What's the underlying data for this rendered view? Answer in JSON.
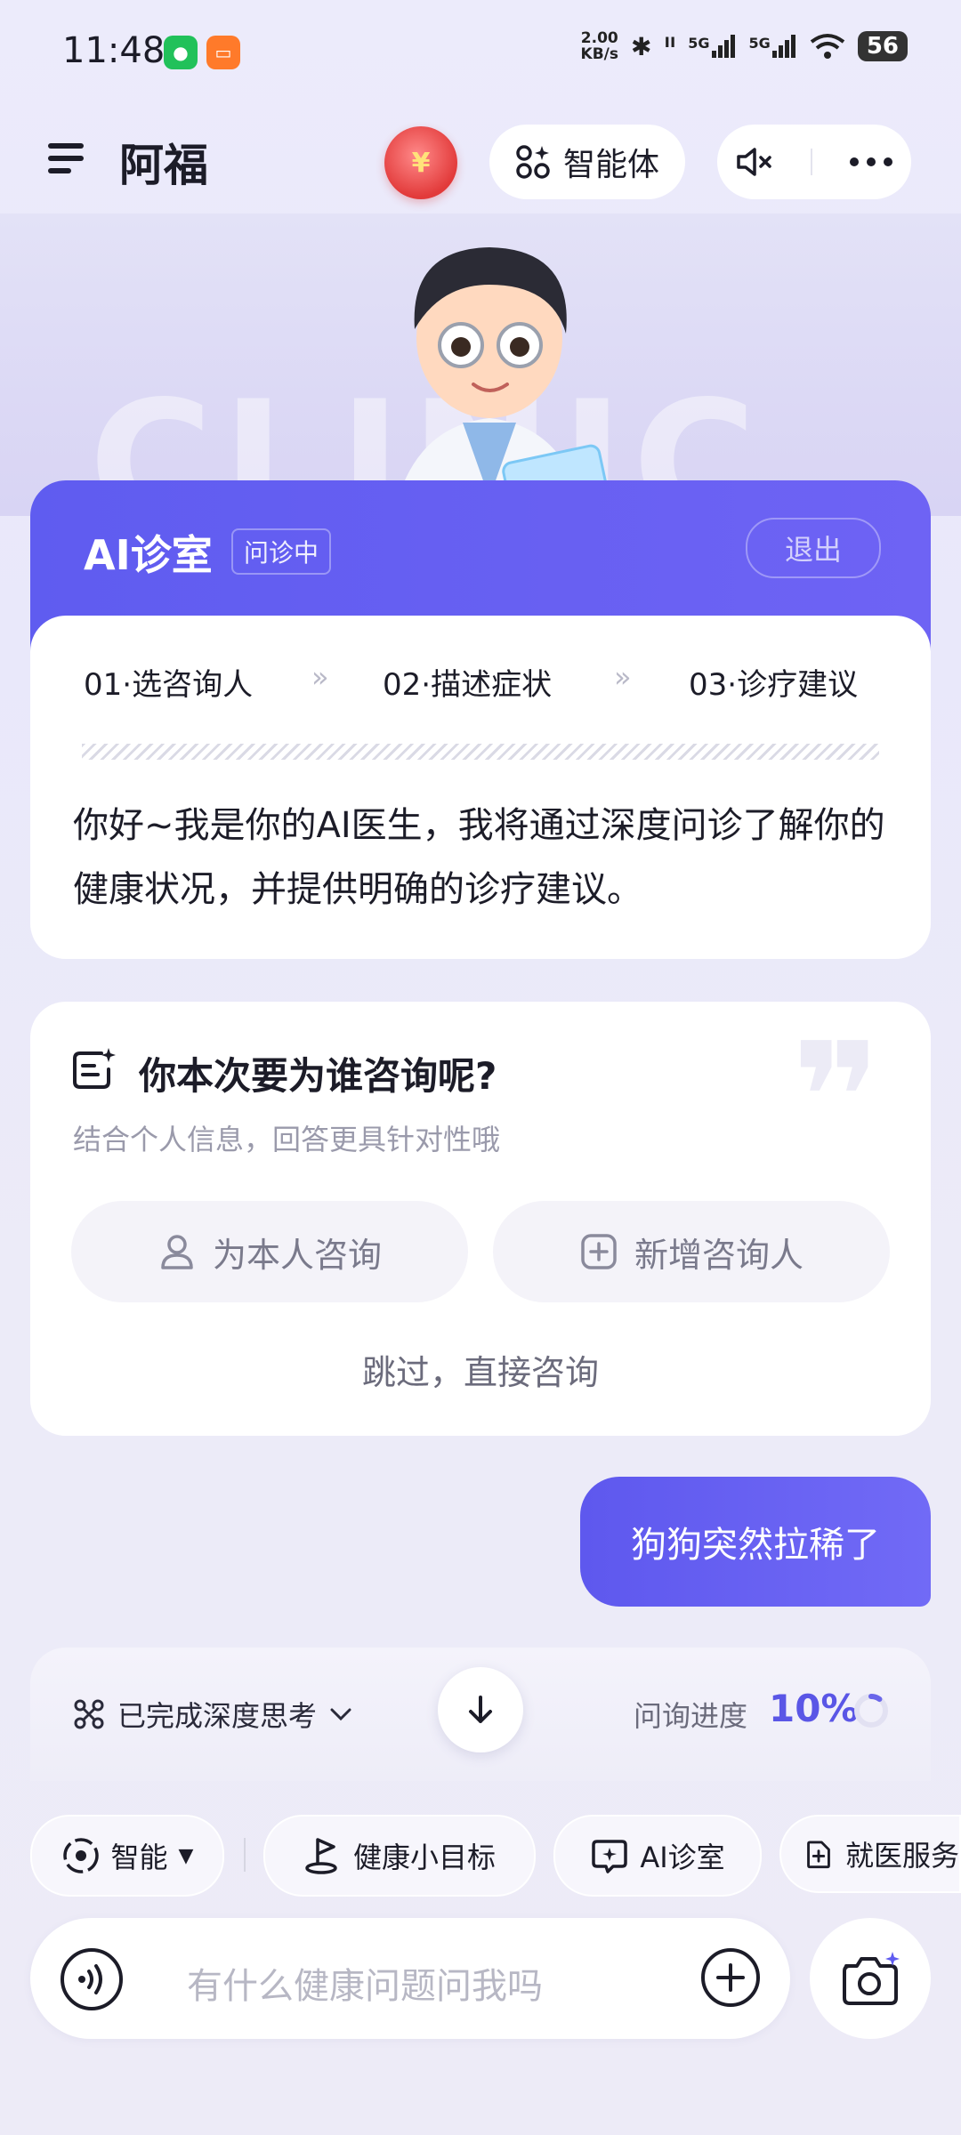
{
  "status_bar": {
    "time": "11:48",
    "net_speed_value": "2.00",
    "net_speed_unit": "KB/s",
    "signal1": "5G",
    "signal2": "5G",
    "battery": "56",
    "icons": [
      "wechat-icon",
      "taobao-icon",
      "bluetooth-icon",
      "earbuds-icon",
      "signal-icon",
      "wifi-icon",
      "battery-icon"
    ]
  },
  "header": {
    "title": "阿福",
    "redpacket_symbol": "¥",
    "agent_label": "智能体"
  },
  "ai_room": {
    "title": "AI诊室",
    "badge": "问诊中",
    "exit": "退出",
    "steps": [
      "01·选咨询人",
      "02·描述症状",
      "03·诊疗建议"
    ],
    "step_separator": "»",
    "intro": "你好~我是你的AI医生，我将通过深度问诊了解你的健康状况，并提供明确的诊疗建议。"
  },
  "consult": {
    "title": "你本次要为谁咨询呢?",
    "subtitle": "结合个人信息，回答更具针对性哦",
    "option_self": "为本人咨询",
    "option_new": "新增咨询人",
    "skip": "跳过，直接咨询"
  },
  "chat": {
    "user_message": "狗狗突然拉稀了"
  },
  "progress": {
    "thinking_label": "已完成深度思考",
    "label": "问询进度",
    "value": "10%",
    "fraction": 0.1
  },
  "chips": [
    {
      "label": "智能",
      "icon": "smart-icon",
      "has_dropdown": true
    },
    {
      "label": "健康小目标",
      "icon": "goal-icon"
    },
    {
      "label": "AI诊室",
      "icon": "ai-room-icon"
    },
    {
      "label": "就医服务",
      "icon": "medical-service-icon"
    }
  ],
  "input": {
    "placeholder": "有什么健康问题问我吗"
  },
  "colors": {
    "accent": "#5F5CF0",
    "accent_text": "#5A56E6",
    "background": "#ECEBFB"
  }
}
